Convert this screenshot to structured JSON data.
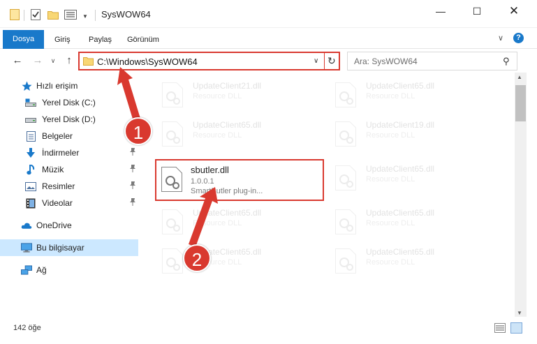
{
  "window": {
    "title": "SysWOW64",
    "minimize_glyph": "—",
    "maximize_glyph": "☐",
    "close_glyph": "✕"
  },
  "ribbon": {
    "tabs": [
      "Dosya",
      "Giriş",
      "Paylaş",
      "Görünüm"
    ],
    "expand_glyph": "∨",
    "help_glyph": "?"
  },
  "navigation": {
    "back_glyph": "←",
    "forward_glyph": "→",
    "recent_glyph": "∨",
    "up_glyph": "↑",
    "address_path": "C:\\Windows\\SysWOW64",
    "address_dropdown_glyph": "∨",
    "refresh_glyph": "↻",
    "search_placeholder": "Ara: SysWOW64",
    "search_glyph": "⚲"
  },
  "sidebar": {
    "items": [
      {
        "label": "Hızlı erişim",
        "icon": "star-icon",
        "color": "#1979ca",
        "pinned": false
      },
      {
        "label": "Yerel Disk (C:)",
        "icon": "drive-icon",
        "color": "#4a5a6a",
        "pinned": false
      },
      {
        "label": "Yerel Disk (D:)",
        "icon": "drive-icon",
        "color": "#4a5a6a",
        "pinned": false
      },
      {
        "label": "Belgeler",
        "icon": "documents-icon",
        "color": "#4a6e9c",
        "pinned": false
      },
      {
        "label": "İndirmeler",
        "icon": "downloads-icon",
        "color": "#1979ca",
        "pinned": true
      },
      {
        "label": "Müzik",
        "icon": "music-icon",
        "color": "#1979ca",
        "pinned": true
      },
      {
        "label": "Resimler",
        "icon": "pictures-icon",
        "color": "#4a6e9c",
        "pinned": true
      },
      {
        "label": "Videolar",
        "icon": "videos-icon",
        "color": "#333333",
        "pinned": true
      },
      {
        "label": "OneDrive",
        "icon": "cloud-icon",
        "color": "#1979ca",
        "pinned": false
      },
      {
        "label": "Bu bilgisayar",
        "icon": "computer-icon",
        "color": "#1979ca",
        "pinned": false
      },
      {
        "label": "Ağ",
        "icon": "network-icon",
        "color": "#1979ca",
        "pinned": false
      }
    ],
    "pin_glyph": "📌"
  },
  "files": [
    {
      "name": "UpdateClient21.dll",
      "description": "Resource DLL",
      "version": "",
      "faded": true
    },
    {
      "name": "UpdateClient65.dll",
      "description": "Resource DLL",
      "version": "",
      "faded": true
    },
    {
      "name": "UpdateClient65.dll",
      "description": "Resource DLL",
      "version": "",
      "faded": true
    },
    {
      "name": "UpdateClient19.dll",
      "description": "Resource DLL",
      "version": "",
      "faded": true
    },
    {
      "name": "sbutler.dll",
      "description": "SmartButler plug-in...",
      "version": "1.0.0.1",
      "faded": false
    },
    {
      "name": "UpdateClient65.dll",
      "description": "Resource DLL",
      "version": "",
      "faded": true
    },
    {
      "name": "UpdateClient65.dll",
      "description": "Resource DLL",
      "version": "",
      "faded": true
    },
    {
      "name": "UpdateClient65.dll",
      "description": "Resource DLL",
      "version": "",
      "faded": true
    },
    {
      "name": "UpdateClient65.dll",
      "description": "Resource DLL",
      "version": "",
      "faded": true
    },
    {
      "name": "UpdateClient65.dll",
      "description": "Resource DLL",
      "version": "",
      "faded": true
    }
  ],
  "status": {
    "item_count": "142 öğe"
  },
  "annotations": {
    "step1": "1",
    "step2": "2",
    "highlight_color": "#d9392f"
  }
}
